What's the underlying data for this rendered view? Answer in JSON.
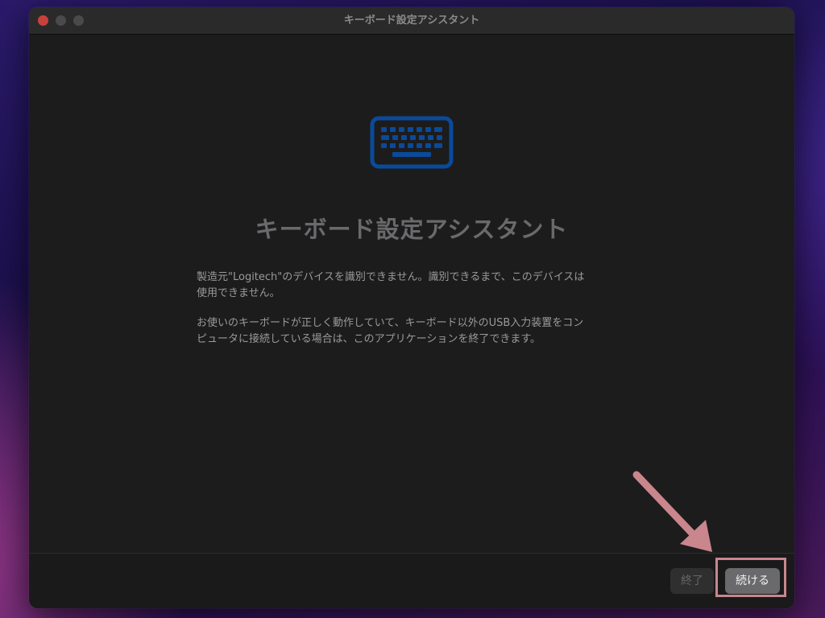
{
  "window": {
    "title": "キーボード設定アシスタント"
  },
  "main": {
    "icon": "keyboard-icon",
    "heading": "キーボード設定アシスタント",
    "paragraph1_line1": "製造元\"Logitech\"のデバイスを識別できません。識別できるまで、このデバイスは",
    "paragraph1_line2": "使用できません。",
    "paragraph2_line1": "お使いのキーボードが正しく動作していて、キーボード以外のUSB入力装置をコン",
    "paragraph2_line2": "ピュータに接続している場合は、このアプリケーションを終了できます。"
  },
  "footer": {
    "quit_label": "終了",
    "continue_label": "続ける"
  },
  "colors": {
    "accent_icon": "#0a4a9a",
    "annotation": "#c9868d"
  }
}
